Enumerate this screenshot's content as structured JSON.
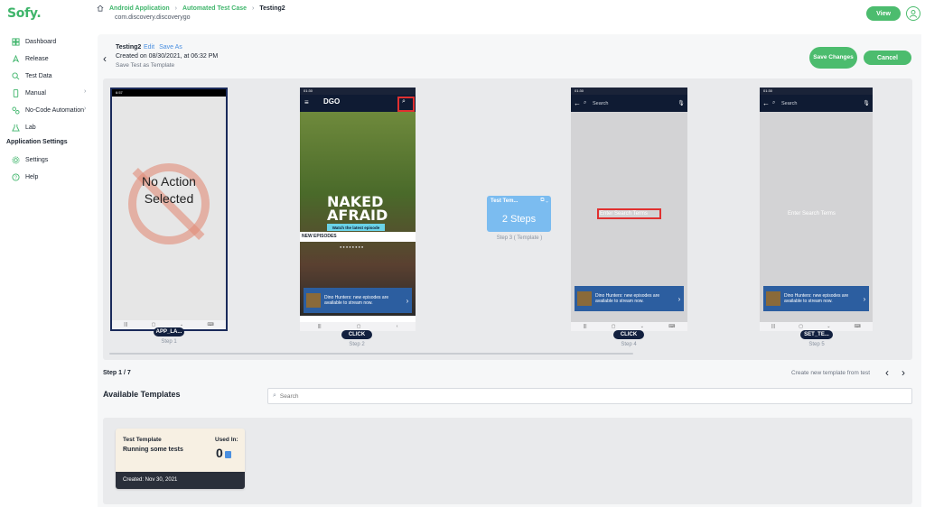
{
  "app": {
    "logo": "Sofy."
  },
  "sidebar": {
    "items": [
      {
        "label": "Dashboard",
        "icon": "dashboard-icon"
      },
      {
        "label": "Release",
        "icon": "rocket-icon"
      },
      {
        "label": "Test Data",
        "icon": "test-data-icon"
      },
      {
        "label": "Manual",
        "icon": "phone-icon",
        "has_submenu": true
      },
      {
        "label": "No-Code Automation",
        "icon": "automation-icon",
        "has_submenu": true
      },
      {
        "label": "Lab",
        "icon": "lab-icon"
      }
    ],
    "section_title": "Application Settings",
    "settings_items": [
      {
        "label": "Settings",
        "icon": "gear-icon"
      },
      {
        "label": "Help",
        "icon": "help-icon"
      }
    ]
  },
  "header": {
    "breadcrumb": [
      "Android Application",
      "Automated Test Case",
      "Testing2"
    ],
    "package_name": "com.discovery.discoverygo",
    "view_label": "View"
  },
  "test": {
    "name": "Testing2",
    "edit_label": "Edit",
    "save_as_label": "Save As",
    "created_on": "Created on 08/30/2021, at 06:32 PM",
    "save_template_label": "Save Test as Template",
    "save_changes_label": "Save Changes",
    "cancel_label": "Cancel"
  },
  "steps": {
    "step1": {
      "text": "No Action Selected",
      "badge": "APP_LA...",
      "label": "Step 1",
      "status": "6:57"
    },
    "step2": {
      "badge": "CLICK",
      "label": "Step 2",
      "status": "01:30",
      "hero_title": "NAKED AFRAID",
      "hero_button": "Watch the latest episode",
      "hero_sub": "Bag Me into a Battle",
      "section": "NEW EPISODES",
      "banner": "Dino Hunters: new episodes are available to stream now."
    },
    "template_step": {
      "title": "Test Tem...",
      "steps": "2 Steps",
      "label": "Step 3 ( Template )"
    },
    "step4": {
      "badge": "CLICK",
      "label": "Step 4",
      "status": "01:30",
      "search_placeholder": "Search",
      "enter_terms": "Enter Search Terms",
      "banner": "Dino Hunters: new episodes are available to stream now."
    },
    "step5": {
      "badge": "SET_TE...",
      "label": "Step 5",
      "status": "01:30",
      "search_placeholder": "Search",
      "enter_terms": "Enter Search Terms",
      "banner": "Dino Hunters: new episodes are available to stream now."
    }
  },
  "footer": {
    "step_count": "Step 1 / 7",
    "create_template": "Create new template from test"
  },
  "templates": {
    "title": "Available Templates",
    "search_placeholder": "Search",
    "cards": [
      {
        "title": "Test Template",
        "description": "Running some tests",
        "used_in_label": "Used In:",
        "used_in_count": "0",
        "created": "Created: Nov 30, 2021"
      }
    ]
  },
  "colors": {
    "brand": "#4cbc6e",
    "link": "#4a8fe0",
    "dark": "#12203f"
  }
}
